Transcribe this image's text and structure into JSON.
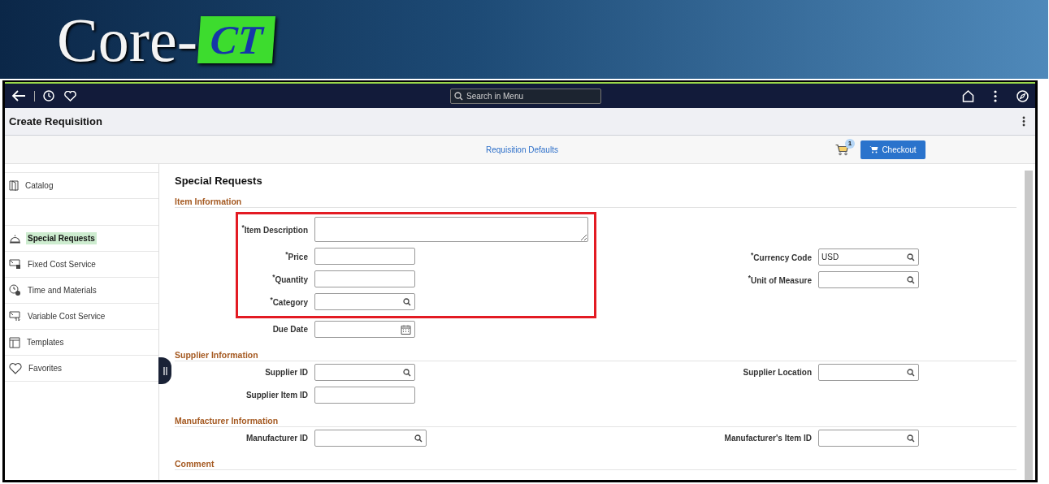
{
  "banner": {
    "logo_text": "Core-",
    "logo_mark": "CT"
  },
  "nav_bar": {
    "search": {
      "placeholder": "Search in Menu"
    }
  },
  "page_title": "Create Requisition",
  "sub_bar": {
    "link": "Requisition Defaults",
    "cart_count": "1",
    "checkout": "Checkout"
  },
  "sidebar": {
    "top_items": [
      {
        "label": "Catalog",
        "kind": "catalog",
        "selected": false
      }
    ],
    "items": [
      {
        "label": "Special Requests",
        "kind": "special",
        "selected": true
      },
      {
        "label": "Fixed Cost Service",
        "kind": "fixed",
        "selected": false
      },
      {
        "label": "Time and Materials",
        "kind": "time",
        "selected": false
      },
      {
        "label": "Variable Cost Service",
        "kind": "variable",
        "selected": false
      },
      {
        "label": "Templates",
        "kind": "templates",
        "selected": false
      },
      {
        "label": "Favorites",
        "kind": "favorites",
        "selected": false
      }
    ]
  },
  "main": {
    "heading": "Special Requests",
    "sections": [
      {
        "title": "Item Information",
        "left_fields": [
          {
            "label": "$^{*}$Item Description",
            "kind": "textarea",
            "highlighted": true
          },
          {
            "label": "$^{*}$Price",
            "kind": "text",
            "highlighted": true
          },
          {
            "label": "$^{*}$Quantity",
            "kind": "text",
            "highlighted": true
          },
          {
            "label": "$^{*}$Category",
            "kind": "lookup",
            "highlighted": true
          },
          {
            "label": "Due Date",
            "kind": "date",
            "highlighted": false
          }
        ],
        "right_fields": [
          {
            "label": "$^{*}$Currency Code",
            "kind": "lookup",
            "value": "USD"
          },
          {
            "label": "$^{*}$Unit of Measure",
            "kind": "lookup"
          }
        ]
      },
      {
        "title": "Supplier Information",
        "left_fields": [
          {
            "label": "Supplier ID",
            "kind": "lookup",
            "highlighted": false
          },
          {
            "label": "Supplier Item ID",
            "kind": "text",
            "highlighted": false
          }
        ],
        "right_fields": [
          {
            "label": "Supplier Location",
            "kind": "lookup"
          }
        ]
      },
      {
        "title": "Manufacturer Information",
        "left_fields": [
          {
            "label": "Manufacturer ID",
            "kind": "wide-lookup",
            "highlighted": false
          }
        ],
        "right_fields": [
          {
            "label": "Manufacturer's Item ID",
            "kind": "lookup"
          }
        ]
      },
      {
        "title": "Comment"
      }
    ]
  }
}
